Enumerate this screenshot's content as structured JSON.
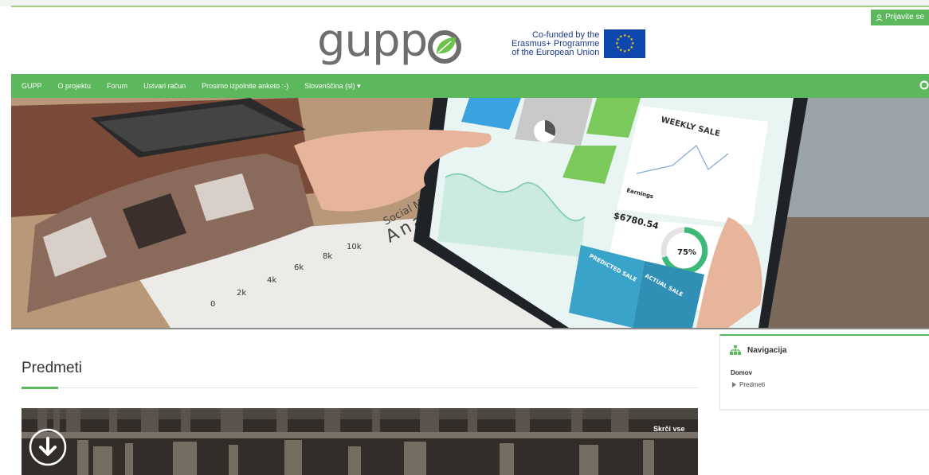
{
  "header": {
    "login_label": "Prijavite se",
    "logo_text": "gupp",
    "erasmus_line1": "Co-funded by the",
    "erasmus_line2": "Erasmus+ Programme",
    "erasmus_line3": "of the European Union"
  },
  "navbar": {
    "items": [
      {
        "label": "GUPP"
      },
      {
        "label": "O projektu"
      },
      {
        "label": "Forum"
      },
      {
        "label": "Ustvari račun"
      },
      {
        "label": "Prosimo izpolnite anketo :-)"
      },
      {
        "label": "Slovenščina (sl) ▾"
      }
    ]
  },
  "hero": {
    "weekly_sale": "WEEKLY SALE",
    "earnings_label": "Earnings",
    "earnings_value": "$6780.54",
    "percent": "75%",
    "predicted": "PREDICTED SALE",
    "actual": "ACTUAL SALE",
    "paper_title_1": "Social Media",
    "paper_title_2": "Analysis",
    "paper_ticks": [
      "0",
      "2k",
      "4k",
      "6k",
      "8k",
      "10k"
    ]
  },
  "main": {
    "title": "Predmeti",
    "hide_all_label": "Skrči vse"
  },
  "sidebar": {
    "block_title": "Navigacija",
    "home_label": "Domov",
    "sub_label": "Predmeti"
  },
  "colors": {
    "brand_green": "#5cb85c",
    "eu_blue": "#0f47af"
  }
}
